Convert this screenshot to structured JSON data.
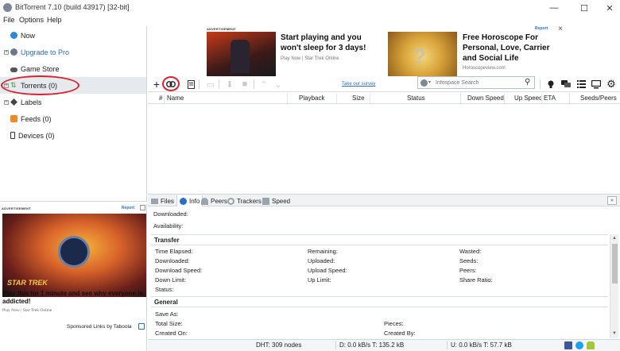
{
  "window": {
    "title": "BitTorrent 7.10  (build 43917) [32-bit]"
  },
  "menu": [
    "File",
    "Options",
    "Help"
  ],
  "sidebar": {
    "items": [
      {
        "label": "Now",
        "icon": "now-icon"
      },
      {
        "label": "Upgrade to Pro",
        "icon": "pro-icon"
      },
      {
        "label": "Game Store",
        "icon": "gamepad-icon"
      },
      {
        "label": "Torrents (0)",
        "icon": "torrents-icon"
      },
      {
        "label": "Labels",
        "icon": "tag-icon"
      },
      {
        "label": "Feeds (0)",
        "icon": "rss-icon"
      },
      {
        "label": "Devices (0)",
        "icon": "device-icon"
      }
    ]
  },
  "side_ad": {
    "label": "ADVERTISEMENT",
    "report": "Report",
    "logo": "STAR TREK",
    "headline": "Play this for 1 minute and see why everyone is addicted!",
    "source": "Play Now | Star Trek Online",
    "sponsored": "Sponsored Links by Taboola"
  },
  "top_ad": {
    "label": "ADVERTISEMENT",
    "report": "Report",
    "close": "×",
    "ad1": {
      "headline": "Start playing and you won't sleep for 3 days!",
      "source": "Play Now | Star Trek Online"
    },
    "ad2": {
      "headline": "Free Horoscope For Personal, Love, Carrier and Social Life",
      "source": "Horoscopeview.com"
    }
  },
  "toolbar": {
    "survey": "Take our survey",
    "search_placeholder": "Infospace Search"
  },
  "columns": [
    "#",
    "Name",
    "Playback",
    "Size",
    "Status",
    "Down Speed",
    "Up Speed",
    "ETA",
    "Seeds/Peers"
  ],
  "tabs": [
    "Files",
    "Info",
    "Peers",
    "Trackers",
    "Speed"
  ],
  "info": {
    "downloaded": "Downloaded:",
    "availability": "Availability:",
    "transfer_title": "Transfer",
    "transfer": [
      [
        "Time Elapsed:",
        "Remaining:",
        "Wasted:"
      ],
      [
        "Downloaded:",
        "Uploaded:",
        "Seeds:"
      ],
      [
        "Download Speed:",
        "Upload Speed:",
        "Peers:"
      ],
      [
        "Down Limit:",
        "Up Limit:",
        "Share Ratio:"
      ],
      [
        "Status:",
        "",
        ""
      ]
    ],
    "general_title": "General",
    "general": [
      [
        "Save As:",
        ""
      ],
      [
        "Total Size:",
        "Pieces:"
      ],
      [
        "Created On:",
        "Created By:"
      ]
    ]
  },
  "statusbar": {
    "dht": "DHT: 309 nodes",
    "down": "D: 0.0 kB/s T: 135.2 kB",
    "up": "U: 0.0 kB/s T: 57.7 kB"
  },
  "colors": {
    "accent": "#2a6fc9",
    "highlight": "#d9232e",
    "upgrade": "#2a6fc9"
  }
}
